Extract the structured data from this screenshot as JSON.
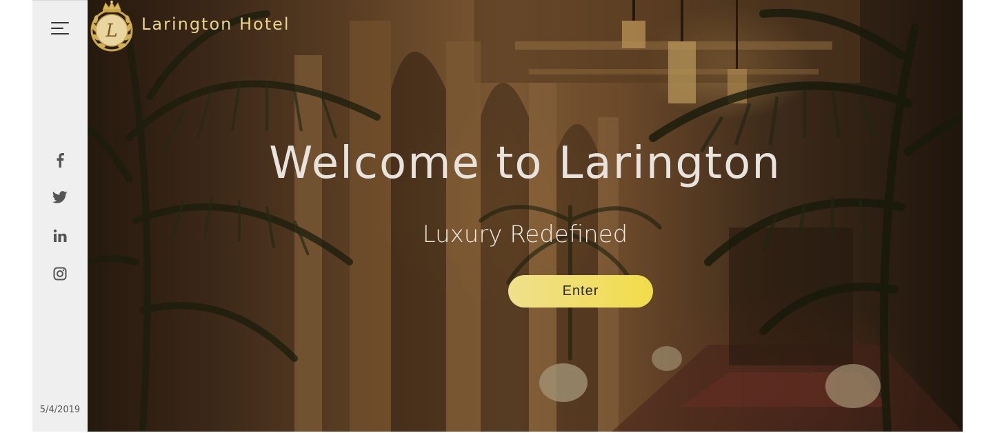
{
  "brand": {
    "name": "Larington Hotel",
    "logo_letter": "L",
    "accent": "#e9d48a"
  },
  "sidebar": {
    "menu_icon": "hamburger-menu-icon",
    "social": [
      {
        "name": "facebook",
        "icon": "facebook-icon"
      },
      {
        "name": "twitter",
        "icon": "twitter-icon"
      },
      {
        "name": "linkedin",
        "icon": "linkedin-icon"
      },
      {
        "name": "instagram",
        "icon": "instagram-icon"
      }
    ],
    "date": "5/4/2019"
  },
  "hero": {
    "headline": "Welcome to Larington",
    "subtitle": "Luxury Redefined",
    "enter_label": "Enter",
    "button_color_start": "#efe08d",
    "button_color_end": "#f2dc4a"
  }
}
